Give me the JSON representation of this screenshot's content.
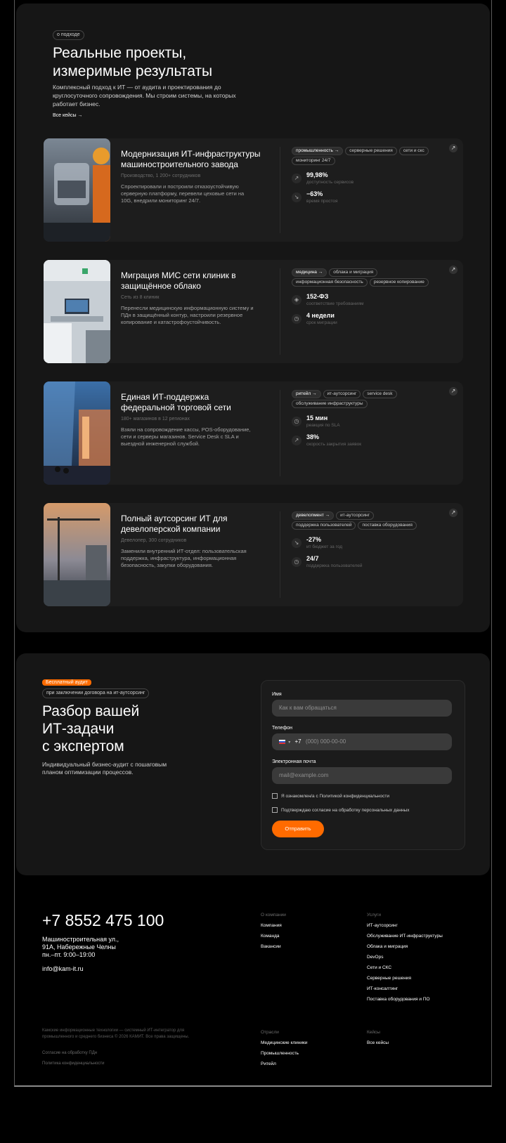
{
  "about": {
    "tag": "о подходе",
    "title_line1": "Реальные проекты,",
    "title_line2": "измеримые результаты",
    "intro": "Комплексный подход к ИТ — от аудита и проектирования до круглосуточного сопровождения. Мы строим системы, на которых работает бизнес.",
    "all_cases_link": "Все кейсы →"
  },
  "cases": [
    {
      "title": "Модернизация ИТ-инфраструктуры машиностроительного завода",
      "subtitle": "Производство, 1 200+ сотрудников",
      "desc": "Спроектировали и построили отказоустойчивую серверную платформу, перевели цеховые сети на 10G, внедрили мониторинг 24/7.",
      "tags": [
        "промышленность →",
        "серверные решения",
        "сети и скс",
        "мониторинг 24/7"
      ],
      "metrics": [
        {
          "icon": "chart-up-icon",
          "value": "99,98%",
          "label": "доступность сервисов"
        },
        {
          "icon": "chart-down-icon",
          "value": "−63%",
          "label": "время простоя"
        }
      ]
    },
    {
      "title": "Миграция МИС сети клиник в защищённое облако",
      "subtitle": "Сеть из 8 клиник",
      "desc": "Перенесли медицинскую информационную систему и ПДн в защищённый контур, настроили резервное копирование и катастрофоустойчивость.",
      "tags": [
        "медицина →",
        "облака и миграция",
        "информационная безопасность",
        "резервное копирование"
      ],
      "metrics": [
        {
          "icon": "shield-icon",
          "value": "152-ФЗ",
          "label": "соответствие требованиям"
        },
        {
          "icon": "clock-icon",
          "value": "4 недели",
          "label": "срок миграции"
        }
      ]
    },
    {
      "title": "Единая ИТ-поддержка федеральной торговой сети",
      "subtitle": "180+ магазинов в 12 регионах",
      "desc": "Взяли на сопровождение кассы, POS-оборудование, сети и серверы магазинов. Service Desk с SLA и выездной инженерной службой.",
      "tags": [
        "ритейл →",
        "ит-аутсорсинг",
        "service desk",
        "обслуживание инфраструктуры"
      ],
      "metrics": [
        {
          "icon": "clock-icon",
          "value": "15 мин",
          "label": "реакция по SLA"
        },
        {
          "icon": "chart-up-icon",
          "value": "38%",
          "label": "скорость закрытия заявок"
        }
      ]
    },
    {
      "title": "Полный аутсорсинг ИТ для девелоперской компании",
      "subtitle": "Девелопер, 300 сотрудников",
      "desc": "Заменили внутренний ИТ-отдел: пользовательская поддержка, инфраструктура, информационная безопасность, закупки оборудования.",
      "tags": [
        "девелопмент →",
        "ит-аутсорсинг",
        "поддержка пользователей",
        "поставка оборудования"
      ],
      "metrics": [
        {
          "icon": "chart-down-icon",
          "value": "-27%",
          "label": "ит бюджет за год"
        },
        {
          "icon": "clock-icon",
          "value": "24/7",
          "label": "поддержка пользователей"
        }
      ]
    }
  ],
  "audit": {
    "badge": "Бесплатный аудит",
    "tag": "при заключении договора на ит-аутсорсинг",
    "title_line1": "Разбор вашей",
    "title_line2": "ИТ-задачи",
    "title_line3": "с экспертом",
    "text": "Индивидуальный бизнес-аудит с пошаговым планом оптимизации процессов."
  },
  "form": {
    "name_label": "Имя",
    "name_placeholder": "Как к вам обращаться",
    "phone_label": "Телефон",
    "phone_prefix": "+7",
    "phone_placeholder": "(000) 000-00-00",
    "email_label": "Электронная почта",
    "email_placeholder": "mail@example.com",
    "consent_privacy": "Я ознакомлен/а с Политикой конфиденциальности",
    "consent_data": "Подтверждаю согласие на обработку персональных данных",
    "submit": "Отправить"
  },
  "footer": {
    "phone": "+7 8552 475 100",
    "address": "Машиностроительная ул.,\n91А, Набережные Челны\nпн.–пт. 9:00–19:00",
    "email": "info@kam-it.ru",
    "company_head": "О компании",
    "company_links": [
      "Компания",
      "Команда",
      "Вакансии"
    ],
    "services_head": "Услуги",
    "services_links": [
      "ИТ-аутсорсинг",
      "Обслуживание ИТ-инфраструктуры",
      "Облака и миграция",
      "DevOps",
      "Сети и СКС",
      "Серверные решения",
      "ИТ-консалтинг",
      "Поставка оборудования и ПО"
    ],
    "legal": "Камские информационные технологии — системный ИТ-интегратор для промышленного и среднего бизнеса © 2026 КАМИТ. Все права защищены.",
    "legal_link1": "Согласие на обработку ПДн",
    "legal_link2": "Политика конфиденциальности",
    "industries_head": "Отрасли",
    "industries_links": [
      "Медицинские клиники",
      "Промышленность",
      "Ритейл"
    ],
    "cases_head": "Кейсы",
    "cases_links": [
      "Все кейсы"
    ]
  }
}
